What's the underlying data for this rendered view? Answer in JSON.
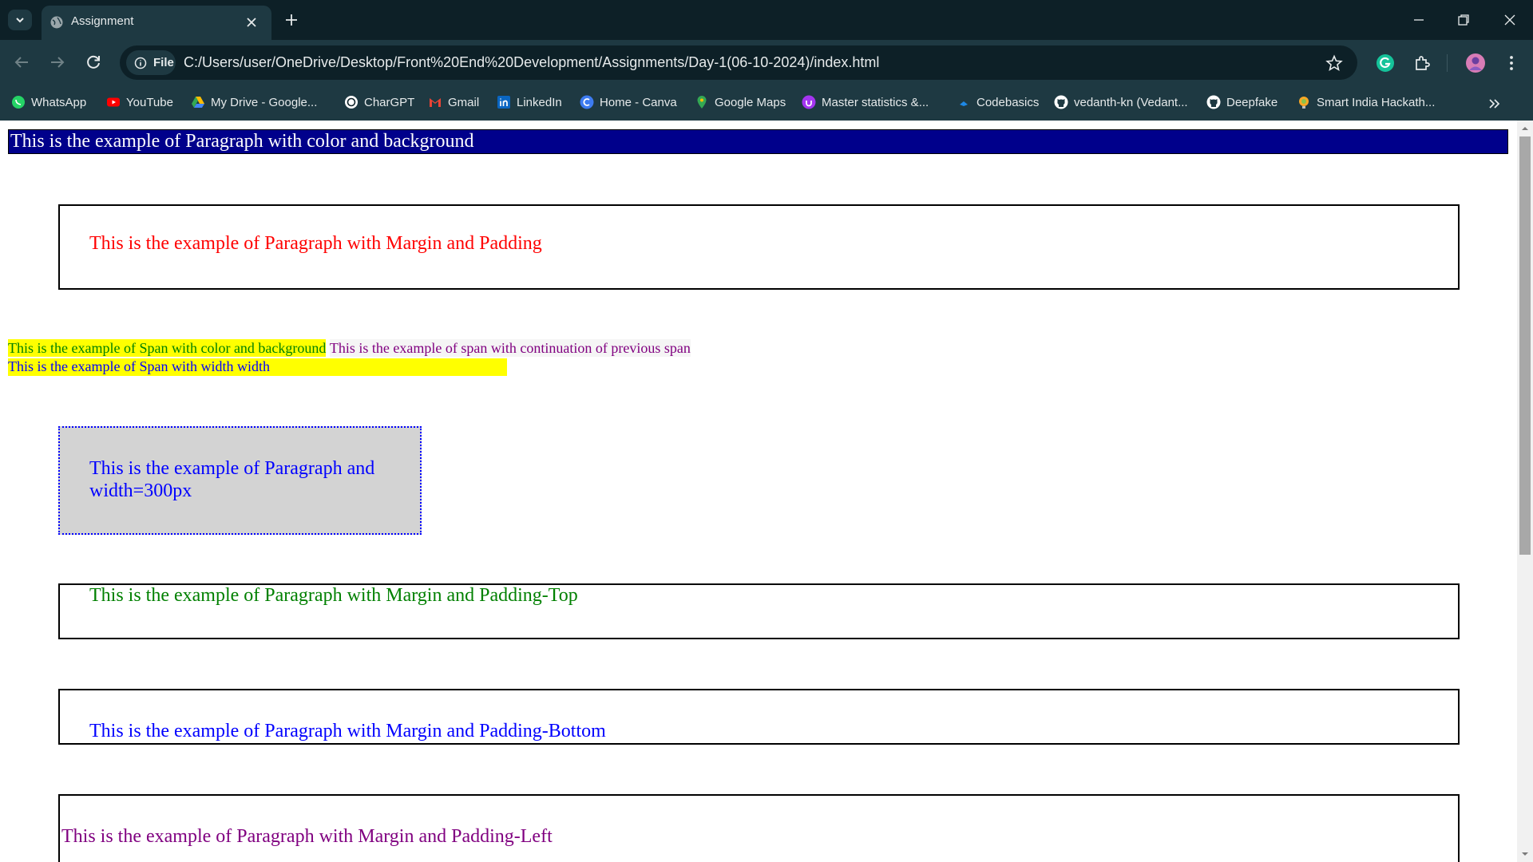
{
  "browser": {
    "tab": {
      "title": "Assignment"
    },
    "address": {
      "chip_label": "File",
      "url": "C:/Users/user/OneDrive/Desktop/Front%20End%20Development/Assignments/Day-1(06-10-2024)/index.html"
    },
    "bookmarks": [
      {
        "label": "WhatsApp",
        "icon": "whatsapp-icon",
        "color": "#25d366"
      },
      {
        "label": "YouTube",
        "icon": "youtube-icon",
        "color": "#ff0000"
      },
      {
        "label": "My Drive - Google...",
        "icon": "google-drive-icon",
        "color": "#fbbc04"
      },
      {
        "label": "CharGPT",
        "icon": "chatgpt-icon",
        "color": "#ffffff"
      },
      {
        "label": "Gmail",
        "icon": "gmail-icon",
        "color": "#ea4335"
      },
      {
        "label": "LinkedIn",
        "icon": "linkedin-icon",
        "color": "#0a66c2"
      },
      {
        "label": "Home - Canva",
        "icon": "canva-icon",
        "color": "#00c4cc"
      },
      {
        "label": "Google Maps",
        "icon": "google-maps-icon",
        "color": "#34a853"
      },
      {
        "label": "Master statistics &...",
        "icon": "udemy-icon",
        "color": "#a435f0"
      },
      {
        "label": "Codebasics",
        "icon": "codebasics-icon",
        "color": "#1e88e5"
      },
      {
        "label": "vedanth-kn (Vedant...",
        "icon": "github-icon",
        "color": "#ffffff"
      },
      {
        "label": "Deepfake",
        "icon": "github-icon",
        "color": "#ffffff"
      },
      {
        "label": "Smart India Hackath...",
        "icon": "sih-icon",
        "color": "#f9a825"
      }
    ]
  },
  "page": {
    "p1": "This is the example of Paragraph with color and background",
    "p2": "This is the example of Paragraph with Margin and Padding",
    "span1": "This is the example of Span with color and background",
    "span2": "This is the example of span with continuation of previous span",
    "span3": "This is the example of Span with width width",
    "p3": "This is the example of Paragraph and width=300px",
    "p4": "This is the example of Paragraph with Margin and Padding-Top",
    "p5": "This is the example of Paragraph with Margin and Padding-Bottom",
    "p6": "This is the example of Paragraph with Margin and Padding-Left"
  },
  "colors": {
    "chrome_dark": "#0d2027",
    "chrome_light": "#1e3942",
    "p1_bg": "#00008b",
    "p1_text": "#ffffff",
    "p2_text": "#ff0000",
    "span1_bg": "#ffff00",
    "span1_text": "#008000",
    "span2_bg": "#f5f5f5",
    "span2_text": "#800080",
    "span3_bg": "#ffff00",
    "span3_text": "#0000ff",
    "p3_bg": "#d3d3d3",
    "p3_text": "#0000ff",
    "p4_text": "#008000",
    "p5_text": "#0000ff",
    "p6_text": "#800080"
  }
}
